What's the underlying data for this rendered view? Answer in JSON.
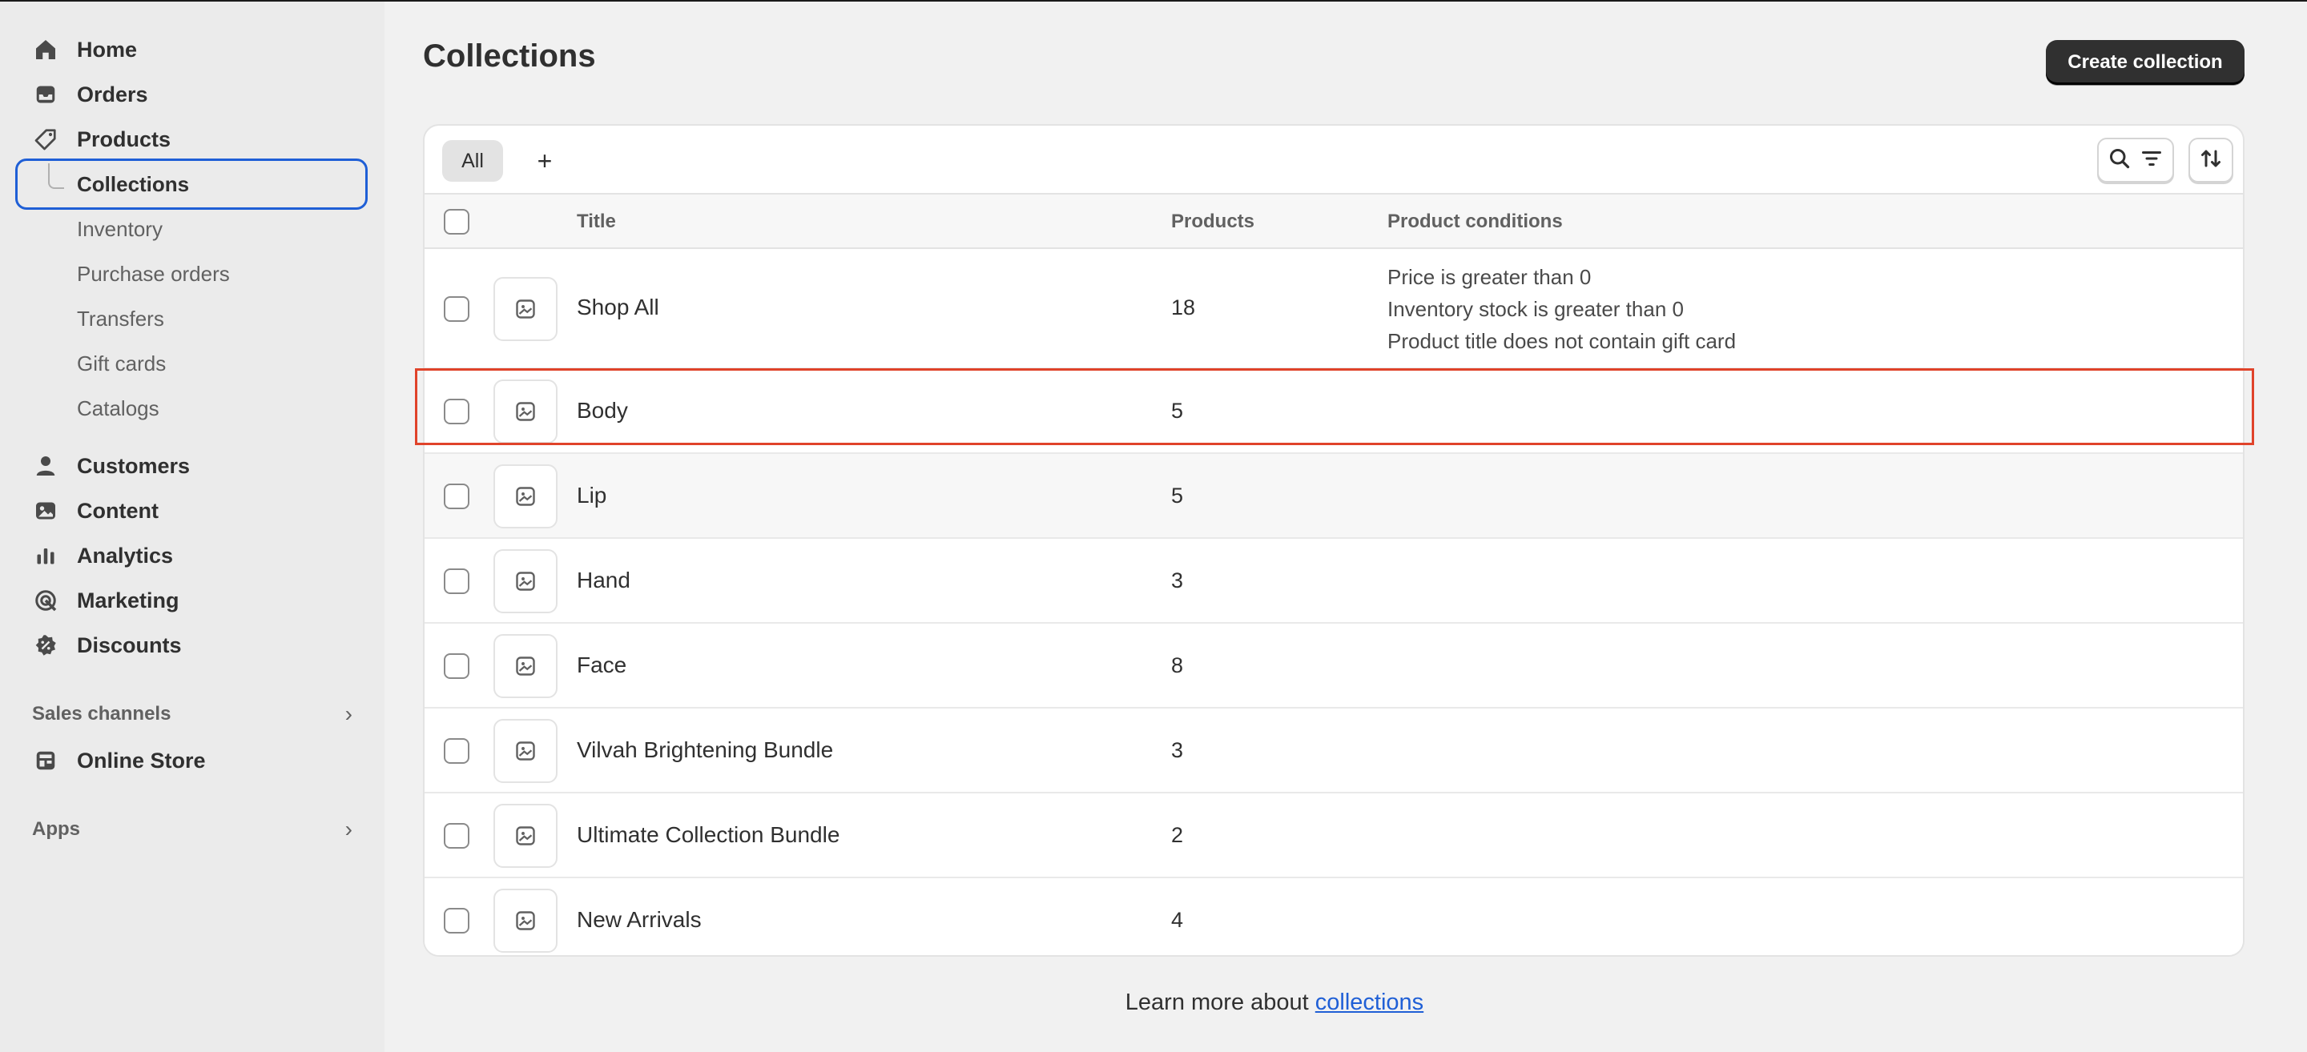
{
  "sidebar": {
    "primary": [
      {
        "label": "Home",
        "icon": "home-icon"
      },
      {
        "label": "Orders",
        "icon": "inbox-icon"
      },
      {
        "label": "Products",
        "icon": "tag-icon"
      }
    ],
    "product_sub": [
      {
        "label": "Collections",
        "active": true
      },
      {
        "label": "Inventory"
      },
      {
        "label": "Purchase orders"
      },
      {
        "label": "Transfers"
      },
      {
        "label": "Gift cards"
      },
      {
        "label": "Catalogs"
      }
    ],
    "secondary": [
      {
        "label": "Customers",
        "icon": "person-icon"
      },
      {
        "label": "Content",
        "icon": "image-icon"
      },
      {
        "label": "Analytics",
        "icon": "bar-chart-icon"
      },
      {
        "label": "Marketing",
        "icon": "target-icon"
      },
      {
        "label": "Discounts",
        "icon": "discount-badge-icon"
      }
    ],
    "sales_channels_label": "Sales channels",
    "online_store_label": "Online Store",
    "apps_label": "Apps"
  },
  "page": {
    "title": "Collections",
    "create_button": "Create collection"
  },
  "tabs": {
    "all_label": "All",
    "add_label": "+"
  },
  "table": {
    "headers": {
      "title": "Title",
      "products": "Products",
      "conditions": "Product conditions"
    },
    "rows": [
      {
        "title": "Shop All",
        "products": "18",
        "conditions": [
          "Price is greater than 0",
          "Inventory stock is greater than 0",
          "Product title does not contain gift card"
        ]
      },
      {
        "title": "Body",
        "products": "5",
        "conditions": []
      },
      {
        "title": "Lip",
        "products": "5",
        "conditions": []
      },
      {
        "title": "Hand",
        "products": "3",
        "conditions": []
      },
      {
        "title": "Face",
        "products": "8",
        "conditions": []
      },
      {
        "title": "Vilvah Brightening Bundle",
        "products": "3",
        "conditions": []
      },
      {
        "title": "Ultimate Collection Bundle",
        "products": "2",
        "conditions": []
      },
      {
        "title": "New Arrivals",
        "products": "4",
        "conditions": []
      }
    ]
  },
  "footer": {
    "text": "Learn more about ",
    "link": "collections"
  },
  "colors": {
    "accent": "#1f5fd6",
    "highlight": "#e0432a",
    "primary_button": "#303030"
  }
}
